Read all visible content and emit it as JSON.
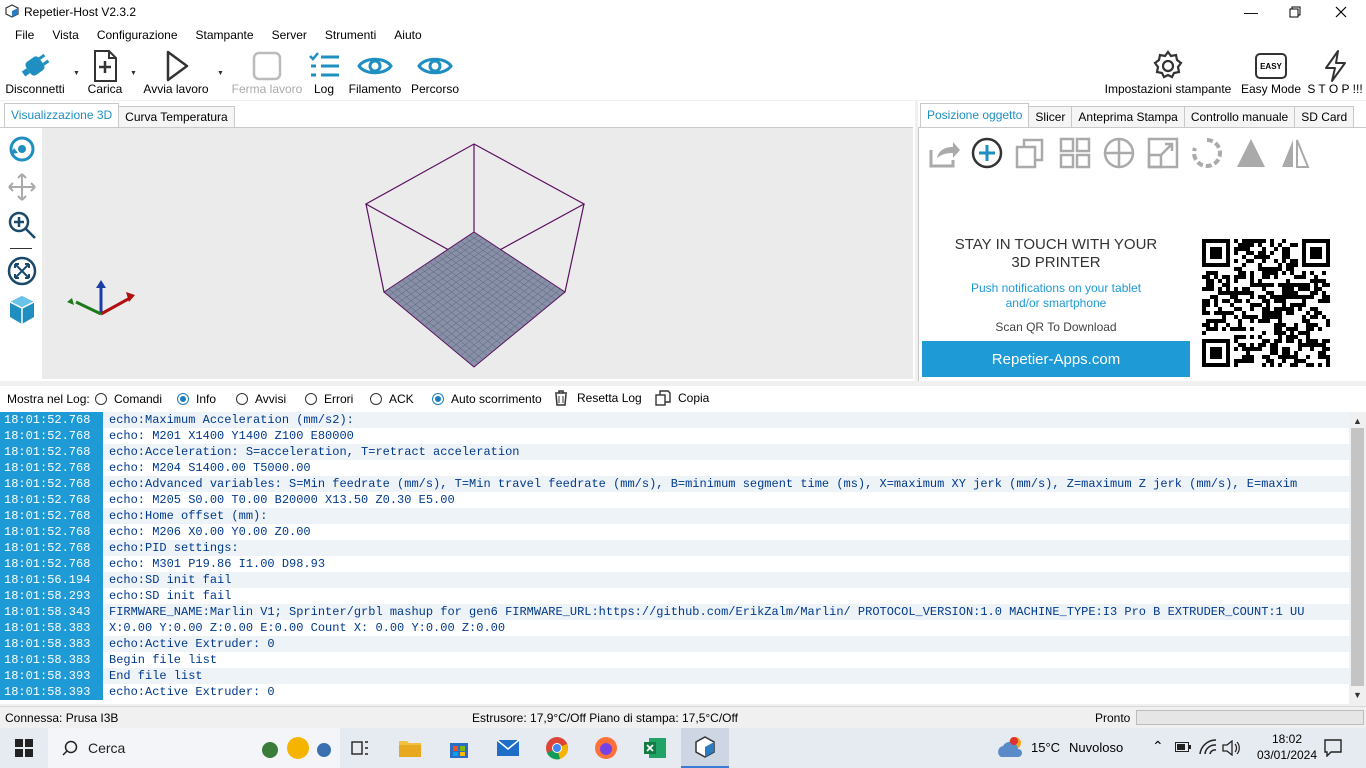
{
  "window": {
    "title": "Repetier-Host V2.3.2"
  },
  "menu": [
    "File",
    "Vista",
    "Configurazione",
    "Stampante",
    "Server",
    "Strumenti",
    "Aiuto"
  ],
  "toolbar": {
    "disconnect": "Disconnetti",
    "load": "Carica",
    "start_job": "Avvia lavoro",
    "stop_job": "Ferma lavoro",
    "log": "Log",
    "filament": "Filamento",
    "path": "Percorso",
    "printer_settings": "Impostazioni stampante",
    "easy_mode": "Easy Mode",
    "easy_badge": "EASY",
    "stop": "S T O P !!!"
  },
  "left_tabs": [
    "Visualizzazione 3D",
    "Curva Temperatura"
  ],
  "right_tabs": [
    "Posizione oggetto",
    "Slicer",
    "Anteprima Stampa",
    "Controllo manuale",
    "SD Card"
  ],
  "promo": {
    "heading_line1": "STAY IN TOUCH WITH YOUR",
    "heading_line2": "3D PRINTER",
    "sub_line1": "Push notifications on your tablet",
    "sub_line2": "and/or smartphone",
    "scan": "Scan QR To Download",
    "button": "Repetier-Apps.com"
  },
  "log_filter": {
    "label": "Mostra nel Log:",
    "commands": "Comandi",
    "info": "Info",
    "warnings": "Avvisi",
    "errors": "Errori",
    "ack": "ACK",
    "autoscroll": "Auto scorrimento",
    "reset": "Resetta Log",
    "copy": "Copia"
  },
  "log_lines": [
    {
      "time": "18:01:52.768",
      "text": "echo:Maximum Acceleration (mm/s2):"
    },
    {
      "time": "18:01:52.768",
      "text": "echo:  M201 X1400 Y1400 Z100 E80000"
    },
    {
      "time": "18:01:52.768",
      "text": "echo:Acceleration: S=acceleration, T=retract acceleration"
    },
    {
      "time": "18:01:52.768",
      "text": "echo:  M204 S1400.00 T5000.00"
    },
    {
      "time": "18:01:52.768",
      "text": "echo:Advanced variables: S=Min feedrate (mm/s), T=Min travel feedrate (mm/s), B=minimum segment time (ms), X=maximum XY jerk (mm/s),  Z=maximum Z jerk (mm/s),  E=maxim"
    },
    {
      "time": "18:01:52.768",
      "text": "echo:  M205 S0.00 T0.00 B20000 X13.50 Z0.30 E5.00"
    },
    {
      "time": "18:01:52.768",
      "text": "echo:Home offset (mm):"
    },
    {
      "time": "18:01:52.768",
      "text": "echo:  M206 X0.00 Y0.00 Z0.00"
    },
    {
      "time": "18:01:52.768",
      "text": "echo:PID settings:"
    },
    {
      "time": "18:01:52.768",
      "text": "echo:   M301 P19.86 I1.00 D98.93"
    },
    {
      "time": "18:01:56.194",
      "text": "echo:SD init fail"
    },
    {
      "time": "18:01:58.293",
      "text": "echo:SD init fail"
    },
    {
      "time": "18:01:58.343",
      "text": "FIRMWARE_NAME:Marlin V1; Sprinter/grbl mashup for gen6 FIRMWARE_URL:https://github.com/ErikZalm/Marlin/ PROTOCOL_VERSION:1.0 MACHINE_TYPE:I3 Pro B  EXTRUDER_COUNT:1 UU"
    },
    {
      "time": "18:01:58.383",
      "text": "X:0.00 Y:0.00 Z:0.00 E:0.00 Count X: 0.00 Y:0.00 Z:0.00"
    },
    {
      "time": "18:01:58.383",
      "text": "echo:Active Extruder: 0"
    },
    {
      "time": "18:01:58.383",
      "text": "Begin file list"
    },
    {
      "time": "18:01:58.393",
      "text": "End file list"
    },
    {
      "time": "18:01:58.393",
      "text": "echo:Active Extruder: 0"
    }
  ],
  "status": {
    "connection": "Connessa: Prusa I3B",
    "temps": "Estrusore: 17,9°C/Off Piano di stampa: 17,5°C/Off",
    "state": "Pronto"
  },
  "taskbar": {
    "search": "Cerca",
    "weather_temp": "15°C",
    "weather_text": "Nuvoloso",
    "time": "18:02",
    "date": "03/01/2024"
  }
}
